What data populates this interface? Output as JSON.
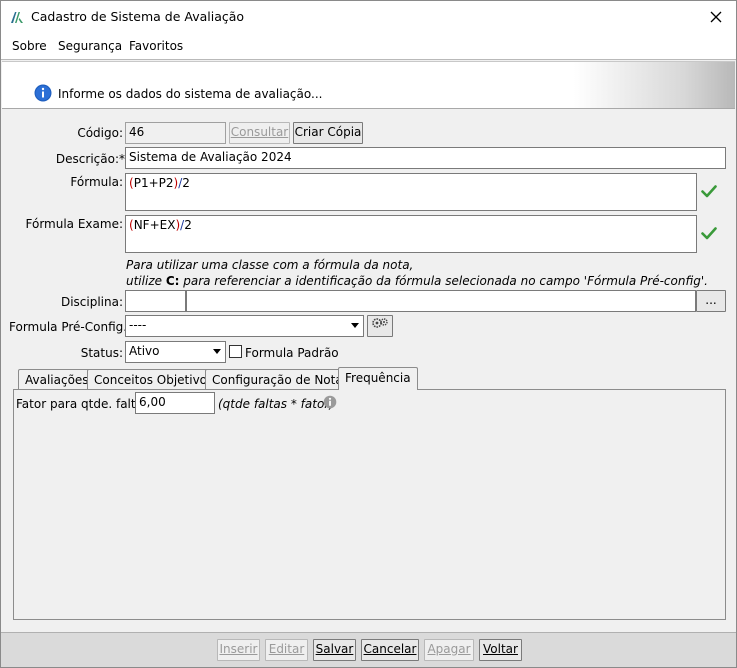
{
  "window": {
    "title": "Cadastro de Sistema de Avaliação"
  },
  "menu": {
    "about": "Sobre",
    "security": "Segurança",
    "favorites": "Favoritos"
  },
  "banner": {
    "message": "Informe os dados do sistema de avaliação..."
  },
  "form": {
    "code_label": "Código:",
    "code_value": "46",
    "consult_button": "Consultar",
    "copy_button": "Criar Cópia",
    "description_label": "Descrição:*",
    "description_value": "Sistema de Avaliação 2024",
    "formula_label": "Fórmula:",
    "formula_value": "(P1+P2)/2",
    "exam_formula_label": "Fórmula Exame:",
    "exam_formula_value": "(NF+EX)/2",
    "hint_line1": "Para utilizar uma classe com a fórmula da nota,",
    "hint_line2_prefix": "utilize ",
    "hint_line2_code": "C:",
    "hint_line2_suffix": " para referenciar a identificação da fórmula selecionada no campo 'Fórmula Pré-config'.",
    "subject_label": "Disciplina:",
    "subject_code": "",
    "subject_name": "",
    "browse_button": "...",
    "preconfig_label": "Formula Pré-Config.:",
    "preconfig_value": "----",
    "status_label": "Status:",
    "status_value": "Ativo",
    "default_formula_label": "Formula Padrão",
    "default_formula_checked": false
  },
  "tabs": [
    "Avaliações",
    "Conceitos Objetivos",
    "Configuração de Notas",
    "Frequência"
  ],
  "active_tab": "Frequência",
  "frequency": {
    "factor_label": "Fator para qtde. faltas:",
    "factor_value": "6,00",
    "factor_hint": "(qtde faltas * fator)"
  },
  "actions": {
    "insert": "Inserir",
    "edit": "Editar",
    "save": "Salvar",
    "cancel": "Cancelar",
    "delete": "Apagar",
    "back": "Voltar"
  },
  "colors": {
    "accent_check": "#3a9a3a",
    "info_blue": "#1f5fbf",
    "paren_red": "#c00000",
    "slash_blue": "#1f3a9e"
  }
}
